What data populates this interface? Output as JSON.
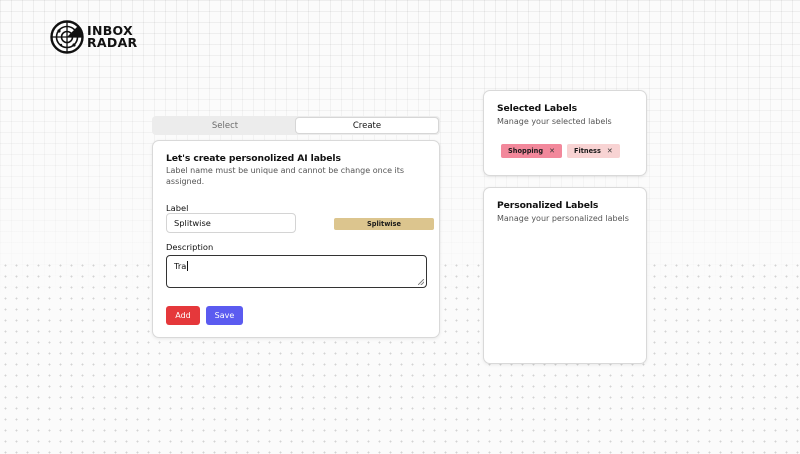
{
  "brand": {
    "line1": "INBOX",
    "line2": "RADAR",
    "logo_icon": "radar-icon"
  },
  "tabs": [
    {
      "label": "Select",
      "active": false
    },
    {
      "label": "Create",
      "active": true
    }
  ],
  "create_card": {
    "title": "Let's create personolized AI labels",
    "subtitle": "Label name must be unique and cannot be change once its assigned.",
    "label_field": {
      "label": "Label",
      "value": "Splitwise"
    },
    "preview_chip": {
      "text": "Splitwise",
      "color": "#dcc58e"
    },
    "description_field": {
      "label": "Description",
      "value": "Tra"
    },
    "add_button": {
      "label": "Add",
      "color": "#e5383b"
    },
    "save_button": {
      "label": "Save",
      "color": "#5b5bf0"
    }
  },
  "selected_labels": {
    "title": "Selected Labels",
    "subtitle": "Manage your selected labels",
    "chips": [
      {
        "text": "Shopping",
        "color": "#f2889b",
        "remove_icon": "close-icon"
      },
      {
        "text": "Fitness",
        "color": "#f8d3d3",
        "remove_icon": "close-icon"
      }
    ]
  },
  "personalized_labels": {
    "title": "Personalized Labels",
    "subtitle": "Manage your personalized labels"
  }
}
